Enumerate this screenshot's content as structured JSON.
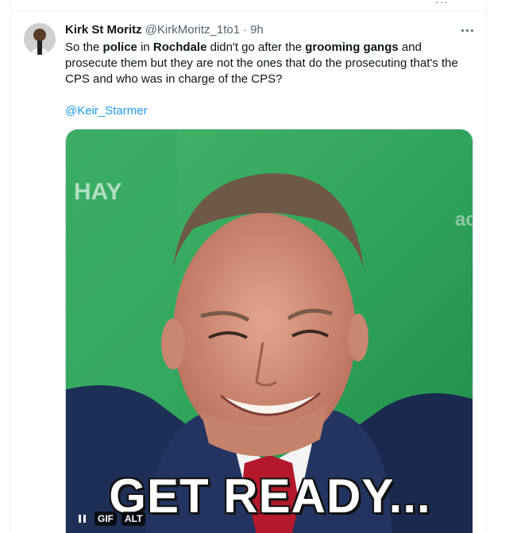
{
  "tweet": {
    "author_name": "Kirk St Moritz",
    "handle": "@KirkMoritz_1to1",
    "separator": "·",
    "time": "9h",
    "text_segments": [
      {
        "t": "So the ",
        "b": false
      },
      {
        "t": "police",
        "b": true
      },
      {
        "t": " in ",
        "b": false
      },
      {
        "t": "Rochdale",
        "b": true
      },
      {
        "t": " didn't go after the ",
        "b": false
      },
      {
        "t": "grooming gangs",
        "b": true
      },
      {
        "t": " and prosecute them but they are not the ones that do the prosecuting that's the CPS and who was in charge of the CPS?",
        "b": false
      }
    ],
    "mention": "@Keir_Starmer"
  },
  "media": {
    "caption": "GET READY...",
    "background_text_left": "HAY",
    "background_text_right": "ac",
    "gif_badge": "GIF",
    "alt_badge": "ALT",
    "pause_icon": "pause-icon"
  },
  "colors": {
    "link": "#1d9bf0",
    "secondary_text": "#536471",
    "primary_text": "#0f1419",
    "backdrop_green": "#2fa45a"
  }
}
